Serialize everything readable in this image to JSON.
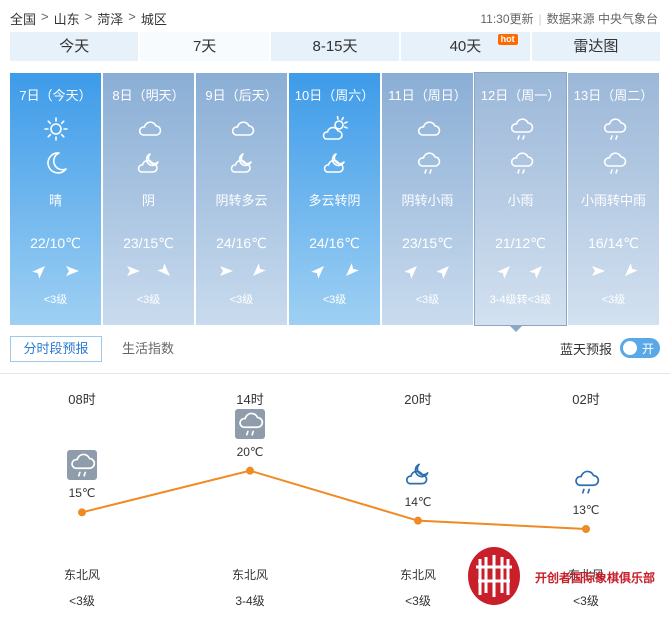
{
  "breadcrumb": [
    "全国",
    "山东",
    "菏泽",
    "城区"
  ],
  "breadcrumb_sep": ">",
  "meta": {
    "updated": "11:30更新",
    "source": "数据来源 中央气象台"
  },
  "tabs": [
    {
      "label": "今天"
    },
    {
      "label": "7天",
      "active": true
    },
    {
      "label": "8-15天"
    },
    {
      "label": "40天",
      "badge": "hot"
    },
    {
      "label": "雷达图"
    }
  ],
  "days": [
    {
      "date": "7日（今天）",
      "icon_day": "sun-icon",
      "icon_night": "moon-icon",
      "desc": "晴",
      "temp": "22/10℃",
      "wind_dir": [
        "东北风",
        "东风"
      ],
      "wind_level": "<3级",
      "style": "sunny"
    },
    {
      "date": "8日（明天）",
      "icon_day": "cloud-icon",
      "icon_night": "cloud-moon-icon",
      "desc": "阴",
      "temp": "23/15℃",
      "wind_dir": [
        "东风",
        "东南风"
      ],
      "wind_level": "<3级",
      "style": "cloudy"
    },
    {
      "date": "9日（后天）",
      "icon_day": "cloud-icon",
      "icon_night": "cloud-moon-icon",
      "desc": "阴转多云",
      "temp": "24/16℃",
      "wind_dir": [
        "东风",
        "西南风"
      ],
      "wind_level": "<3级",
      "style": "cloudy"
    },
    {
      "date": "10日（周六）",
      "icon_day": "sun-cloud-icon",
      "icon_night": "cloud-moon-icon",
      "desc": "多云转阴",
      "temp": "24/16℃",
      "wind_dir": [
        "东北风",
        "西南风"
      ],
      "wind_level": "<3级",
      "style": "sunny"
    },
    {
      "date": "11日（周日）",
      "icon_day": "cloud-icon",
      "icon_night": "rain-cloud-icon",
      "desc": "阴转小雨",
      "temp": "23/15℃",
      "wind_dir": [
        "东北风",
        "东北风"
      ],
      "wind_level": "<3级",
      "style": "cloudy"
    },
    {
      "date": "12日（周一）",
      "icon_day": "rain-cloud-icon",
      "icon_night": "rain-cloud-icon",
      "desc": "小雨",
      "temp": "21/12℃",
      "wind_dir": [
        "东北风",
        "东北风"
      ],
      "wind_level": "3-4级转<3级",
      "style": "rain",
      "selected": true
    },
    {
      "date": "13日（周二）",
      "icon_day": "rain-cloud-icon",
      "icon_night": "rain-cloud-icon",
      "desc": "小雨转中雨",
      "temp": "16/14℃",
      "wind_dir": [
        "东风",
        "西南风"
      ],
      "wind_level": "<3级",
      "style": "rain"
    }
  ],
  "subtabs": {
    "hourly": "分时段预报",
    "life": "生活指数"
  },
  "blue_sky": {
    "label": "蓝天预报",
    "toggle": "开"
  },
  "hourly": [
    {
      "time": "08时",
      "icon": "rain-cloud-icon",
      "temp": "15℃",
      "temp_value": 15,
      "wind": "东北风",
      "level": "<3级"
    },
    {
      "time": "14时",
      "icon": "rain-cloud-icon",
      "temp": "20℃",
      "temp_value": 20,
      "wind": "东北风",
      "level": "3-4级"
    },
    {
      "time": "20时",
      "icon": "cloud-moon-icon",
      "temp": "14℃",
      "temp_value": 14,
      "wind": "东北风",
      "level": "<3级"
    },
    {
      "time": "02时",
      "icon": "rain-cloud-icon",
      "temp": "13℃",
      "temp_value": 13,
      "wind": "东北风",
      "level": "<3级"
    }
  ],
  "colors": {
    "accent": "#f08a24",
    "tab_bg": "#e6f1fa",
    "toggle": "#59a8e8",
    "watermark": "#c81f2b"
  },
  "watermark": {
    "text": "开创者国际象棋俱乐部"
  }
}
